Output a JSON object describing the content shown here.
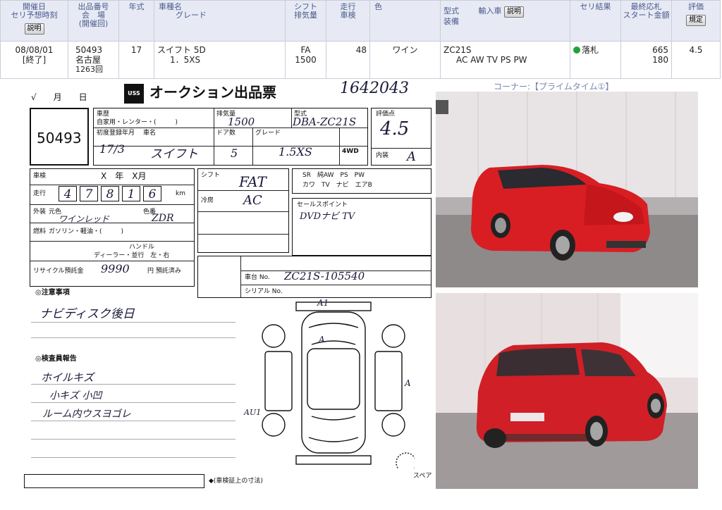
{
  "header": {
    "columns": [
      {
        "label1": "開催日",
        "label2": "セリ予想時刻",
        "button": "説明"
      },
      {
        "label1": "出品番号",
        "label2": "会　場",
        "label3": "(開催回)"
      },
      {
        "label1": "年式"
      },
      {
        "label1": "車種名",
        "label2": "グレード"
      },
      {
        "label1": "シフト",
        "label2": "排気量"
      },
      {
        "label1": "走行",
        "label2": "車検"
      },
      {
        "label1": "色"
      },
      {
        "label1": "型式",
        "label1b": "輸入車",
        "button": "説明",
        "label2": "装備"
      },
      {
        "label1": "セリ結果"
      },
      {
        "label1": "最終応札",
        "label2": "スタート金額"
      },
      {
        "label1": "評価",
        "button": "規定"
      }
    ],
    "row": {
      "date": "08/08/01",
      "status": "[終了]",
      "lot": "50493",
      "venue": "名古屋",
      "session": "1263回",
      "year": "17",
      "model": "スイフト 5D",
      "grade": "1．5XS",
      "shift": "FA",
      "displacement": "1500",
      "mileage": "48",
      "color": "ワイン",
      "type_code": "ZC21S",
      "equipment": "AC AW TV PS PW",
      "result": "落札",
      "final_bid": "665",
      "start_price": "180",
      "rating": "4.5"
    },
    "result_color": "#21a33a"
  },
  "corner_label": "コーナー:【プライムタイム①】",
  "sheet": {
    "logo": "USS",
    "title": "オークション出品票",
    "top_number": "1642043",
    "lot_number": "50493",
    "labels": {
      "car_history": "車歴",
      "car_history_options": "自家用・レンター・(　　　)",
      "displacement": "排気量",
      "model_code": "型式",
      "first_reg": "初度登録年月",
      "car_name": "車名",
      "doors": "ドア数",
      "grade": "グレード",
      "score": "評価点",
      "interior": "内装",
      "inspection": "車検",
      "year_month": "X　年　X月",
      "mileage": "走行",
      "mileage_unit": "km",
      "shift": "シフト",
      "aircon": "冷房",
      "exterior_color": "外装",
      "original_color": "元色",
      "color_code": "色番",
      "fuel": "燃料",
      "fuel_options": "ガソリン・軽油・(　　　)",
      "handle": "ハンドル",
      "dealer": "ディーラー・並行　左・右",
      "recycle": "リサイクル預託金",
      "recycle_unit": "円 預託済み",
      "equipment_codes": "SR　純AW　PS　PW",
      "equipment_codes2": "カワ　TV　ナビ　エアB",
      "sales_point": "セールスポイント",
      "serial": "シリアル No.",
      "chassis": "車台 No.",
      "notes": "◎注意事項",
      "inspector": "◎検査員報告",
      "spare": "スペア",
      "bottom_note": "◆(車検証上の寸法)"
    },
    "hand": {
      "displacement": "1500",
      "model_code": "DBA-ZC21S",
      "score": "4.5",
      "interior": "A",
      "first_reg": "17/3",
      "car_name": "スイフト",
      "doors": "5",
      "grade": "1.5XS",
      "drive": "4WD",
      "mileage_digits": [
        "4",
        "7",
        "8",
        "1",
        "6"
      ],
      "shift": "FAT",
      "aircon": "AC",
      "color": "ワインレッド",
      "color_code": "ZDR",
      "recycle": "9990",
      "sales_point": "DVDナビ TV",
      "chassis": "ZC21S-105540",
      "notes": "ナビディスク後日",
      "inspector_line1": "ホイルキズ",
      "inspector_line2": "小キズ 小凹",
      "inspector_line3": "ルーム内ウスヨゴレ",
      "mark_a1": "A1",
      "mark_a2": "A",
      "mark_a3": "A",
      "mark_au1": "AU1"
    }
  }
}
